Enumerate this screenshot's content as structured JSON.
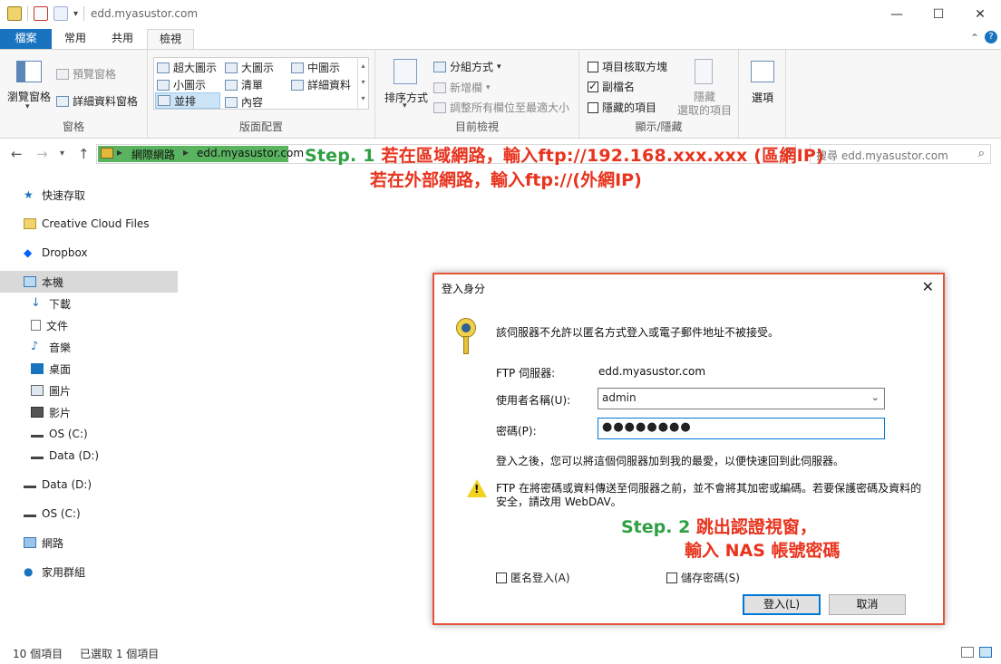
{
  "window": {
    "title": "edd.myasustor.com",
    "minimize": "—",
    "maximize": "☐",
    "close": "✕"
  },
  "tabs": [
    {
      "label": "檔案"
    },
    {
      "label": "常用"
    },
    {
      "label": "共用"
    },
    {
      "label": "檢視"
    }
  ],
  "ribbon": {
    "panes": {
      "label": "窗格",
      "nav_pane": "瀏覽窗格",
      "preview": "預覽窗格",
      "details": "詳細資料窗格"
    },
    "layout": {
      "label": "版面配置",
      "items": [
        "超大圖示",
        "大圖示",
        "中圖示",
        "小圖示",
        "清單",
        "詳細資料",
        "並排",
        "內容"
      ],
      "selected": "並排"
    },
    "current_view": {
      "label": "目前檢視",
      "sort_by": "排序方式",
      "group_by": "分組方式",
      "add_columns": "新增欄",
      "size_all_columns": "調整所有欄位至最適大小"
    },
    "show_hide": {
      "label": "顯示/隱藏",
      "item_checkboxes": {
        "label": "項目核取方塊",
        "checked": false
      },
      "file_extensions": {
        "label": "副檔名",
        "checked": true
      },
      "hidden_items": {
        "label": "隱藏的項目",
        "checked": false
      },
      "hide_selected_line1": "隱藏",
      "hide_selected_line2": "選取的項目"
    },
    "options": "選項"
  },
  "address_bar": {
    "segments": [
      "網際網路",
      "edd.myasustor.com"
    ],
    "search_placeholder": "搜尋 edd.myasustor.com"
  },
  "annotations": {
    "step1_prefix": "Step. 1",
    "step1_line1": " 若在區域網路，輸入ftp://192.168.xxx.xxx (區網IP)",
    "step1_line2": "若在外部網路，輸入ftp://(外網IP)",
    "step2_prefix": "Step. 2",
    "step2_line1": " 跳出認證視窗，",
    "step2_line2": "輸入 NAS 帳號密碼"
  },
  "nav_pane": {
    "items": [
      {
        "label": "快速存取"
      },
      {
        "label": "Creative Cloud Files"
      },
      {
        "label": "Dropbox"
      },
      {
        "label": "本機"
      },
      {
        "label": "下載"
      },
      {
        "label": "文件"
      },
      {
        "label": "音樂"
      },
      {
        "label": "桌面"
      },
      {
        "label": "圖片"
      },
      {
        "label": "影片"
      },
      {
        "label": "OS (C:)"
      },
      {
        "label": "Data (D:)"
      },
      {
        "label": "Data (D:)"
      },
      {
        "label": "OS (C:)"
      },
      {
        "label": "網路"
      },
      {
        "label": "家用群組"
      }
    ]
  },
  "status_bar": {
    "item_count": "10 個項目",
    "selected": "已選取 1 個項目"
  },
  "dialog": {
    "title": "登入身分",
    "message": "該伺服器不允許以匿名方式登入或電子郵件地址不被接受。",
    "server_label": "FTP 伺服器:",
    "server_value": "edd.myasustor.com",
    "username_label": "使用者名稱(U):",
    "username_value": "admin",
    "password_label": "密碼(P):",
    "password_value": "●●●●●●●●",
    "after_login_note": "登入之後，您可以將這個伺服器加到我的最愛，以便快速回到此伺服器。",
    "warning_line1": "FTP 在將密碼或資料傳送至伺服器之前，並不會將其加密或編碼。若要保護密碼及資料的",
    "warning_line2": "安全，請改用 WebDAV。",
    "anonymous_label": "匿名登入(A)",
    "anonymous_checked": false,
    "save_password_label": "儲存密碼(S)",
    "save_password_checked": false,
    "login_button": "登入(L)",
    "cancel_button": "取消"
  }
}
